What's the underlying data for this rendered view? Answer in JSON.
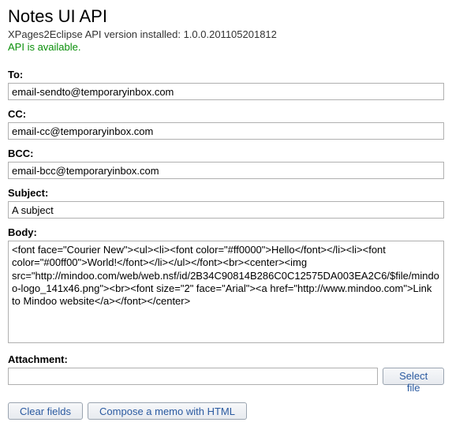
{
  "header": {
    "title": "Notes UI API",
    "version_line": "XPages2Eclipse API version installed: 1.0.0.201105201812",
    "status": "API is available."
  },
  "fields": {
    "to": {
      "label": "To:",
      "value": "email-sendto@temporaryinbox.com"
    },
    "cc": {
      "label": "CC:",
      "value": "email-cc@temporaryinbox.com"
    },
    "bcc": {
      "label": "BCC:",
      "value": "email-bcc@temporaryinbox.com"
    },
    "subject": {
      "label": "Subject:",
      "value": "A subject"
    },
    "body": {
      "label": "Body:",
      "value": "<font face=\"Courier New\"><ul><li><font color=\"#ff0000\">Hello</font></li><li><font color=\"#00ff00\">World!</font></li></ul></font><br><center><img src=\"http://mindoo.com/web/web.nsf/id/2B34C90814B286C0C12575DA003EA2C6/$file/mindoo-logo_141x46.png\"><br><font size=\"2\" face=\"Arial\"><a href=\"http://www.mindoo.com\">Link to Mindoo website</a></font></center>"
    },
    "attachment": {
      "label": "Attachment:",
      "value": ""
    }
  },
  "buttons": {
    "select_file": "Select file",
    "clear_fields": "Clear fields",
    "compose": "Compose a memo with HTML"
  }
}
